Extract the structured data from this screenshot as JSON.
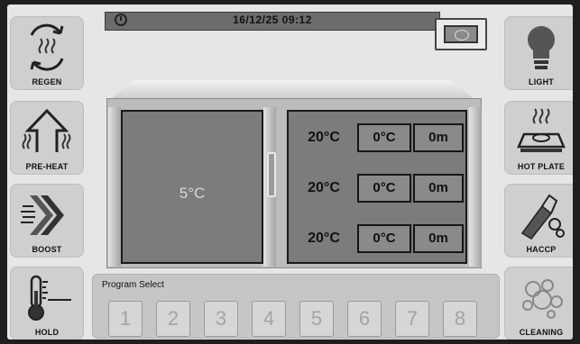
{
  "header": {
    "datetime": "16/12/25 09:12",
    "clock_icon": "clock-icon"
  },
  "left_buttons": [
    {
      "label": "REGEN",
      "icon": "regen-icon"
    },
    {
      "label": "PRE-HEAT",
      "icon": "pre-heat-icon"
    },
    {
      "label": "BOOST",
      "icon": "boost-icon"
    },
    {
      "label": "HOLD",
      "icon": "thermometer-icon"
    }
  ],
  "right_buttons": [
    {
      "label": "LIGHT",
      "icon": "light-bulb-icon"
    },
    {
      "label": "HOT PLATE",
      "icon": "hot-plate-icon"
    },
    {
      "label": "HACCP",
      "icon": "haccp-icon"
    },
    {
      "label": "CLEANING",
      "icon": "cleaning-icon"
    }
  ],
  "left_compartment": {
    "temp": "5°C"
  },
  "right_compartment": {
    "shelves": [
      {
        "current": "20°C",
        "setpoint": "0°C",
        "time": "0m"
      },
      {
        "current": "20°C",
        "setpoint": "0°C",
        "time": "0m"
      },
      {
        "current": "20°C",
        "setpoint": "0°C",
        "time": "0m"
      }
    ]
  },
  "program": {
    "title": "Program Select",
    "buttons": [
      "1",
      "2",
      "3",
      "4",
      "5",
      "6",
      "7",
      "8"
    ]
  },
  "colors": {
    "screen_bg": "#e6e6e6",
    "cabinet_fill": "#7c7c7c",
    "button_bg": "#cfcfcf"
  }
}
